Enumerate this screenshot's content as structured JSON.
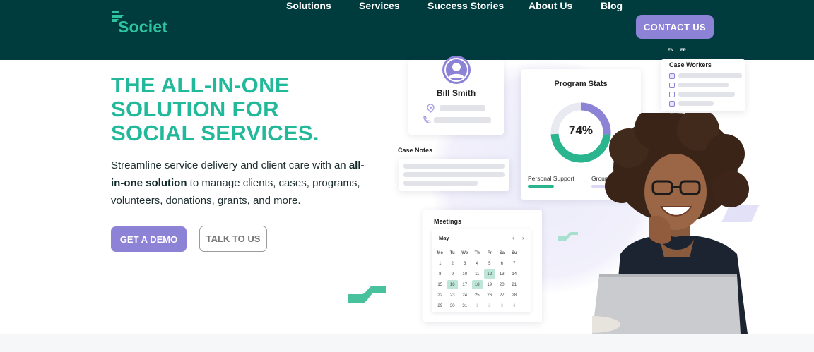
{
  "brand": {
    "name": "Societ",
    "primary_color": "#003b3e",
    "accent_teal": "#22b89a",
    "accent_purple": "#8c82d6"
  },
  "nav": {
    "items": [
      "Solutions",
      "Services",
      "Success Stories",
      "About Us",
      "Blog"
    ],
    "contact_label": "CONTACT US",
    "languages": [
      "EN",
      "FR"
    ]
  },
  "hero": {
    "title_lines": [
      "THE ALL-IN-ONE",
      "SOLUTION FOR",
      "SOCIAL SERVICES."
    ],
    "desc_pre": "Streamline service delivery and client care with an ",
    "desc_bold": "all-in-one solution",
    "desc_post": " to manage clients, cases, programs, volunteers, donations, grants, and more.",
    "demo_label": "GET A DEMO",
    "talk_label": "TALK TO US"
  },
  "illustration": {
    "client_name": "Bill Smith",
    "case_notes_title": "Case Notes",
    "stats_title": "Program Stats",
    "stats_percent": "74%",
    "stats_value": 0.74,
    "stats_legend": [
      "Personal Support",
      "Group Support"
    ],
    "workers_title": "Case Workers",
    "workers_checked": [
      true,
      false,
      false,
      true
    ],
    "meetings_title": "Meetings",
    "calendar": {
      "month": "May",
      "weekdays": [
        "Mo",
        "Tu",
        "We",
        "Th",
        "Fr",
        "Sa",
        "Su"
      ],
      "weeks": [
        [
          "1",
          "2",
          "3",
          "4",
          "5",
          "6",
          "7"
        ],
        [
          "8",
          "9",
          "10",
          "11",
          "12",
          "13",
          "14"
        ],
        [
          "15",
          "16",
          "17",
          "18",
          "19",
          "20",
          "21"
        ],
        [
          "22",
          "23",
          "24",
          "25",
          "26",
          "27",
          "28"
        ],
        [
          "29",
          "30",
          "31",
          "1",
          "2",
          "3",
          "4"
        ]
      ],
      "highlighted": [
        "12",
        "16",
        "18"
      ],
      "next_month_start_index": 3
    }
  }
}
